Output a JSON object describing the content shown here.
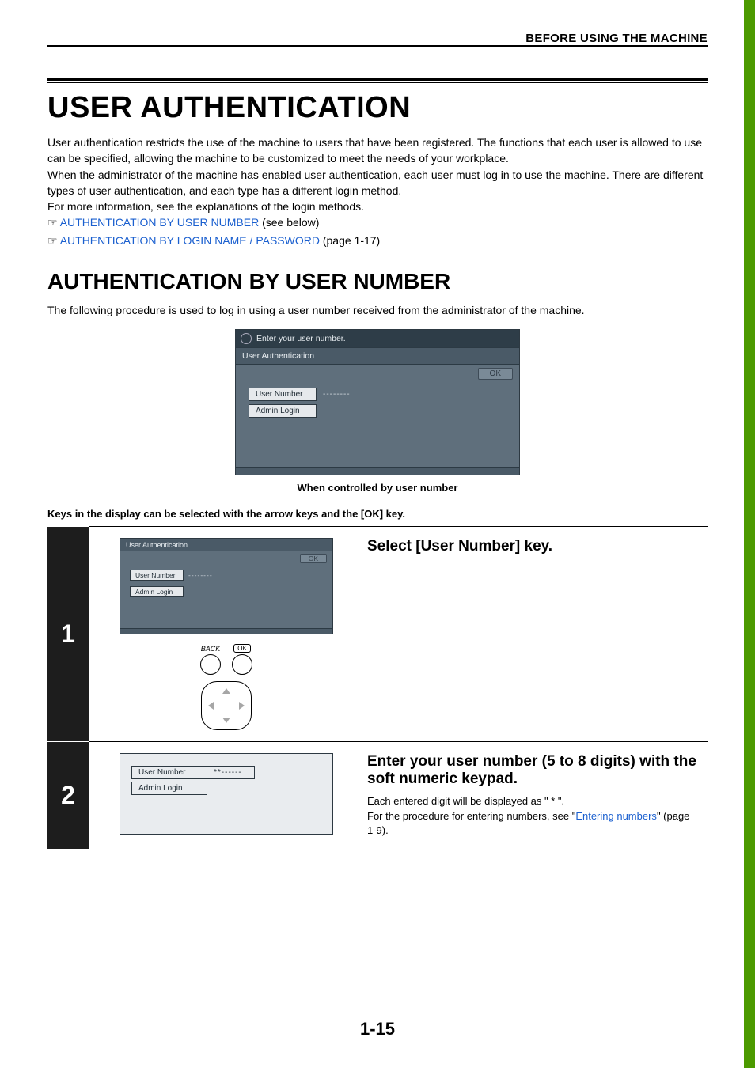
{
  "header": {
    "breadcrumb": "BEFORE USING THE MACHINE"
  },
  "title": "USER AUTHENTICATION",
  "intro": {
    "p1": "User authentication restricts the use of the machine to users that have been registered. The functions that each user is allowed to use can be specified, allowing the machine to be customized to meet the needs of your workplace.",
    "p2": "When the administrator of the machine has enabled user authentication, each user must log in to use the machine. There are different types of user authentication, and each type has a different login method.",
    "p3": "For more information, see the explanations of the login methods."
  },
  "links": {
    "pointer": "☞",
    "l1_text": "AUTHENTICATION BY USER NUMBER",
    "l1_suffix": " (see below)",
    "l2_text": "AUTHENTICATION BY LOGIN NAME / PASSWORD",
    "l2_suffix": " (page 1-17)"
  },
  "section2": {
    "heading": "AUTHENTICATION BY USER NUMBER",
    "lead": "The following procedure is used to log in using a user number received from the administrator of the machine."
  },
  "main_screen": {
    "prompt": "Enter your user number.",
    "subtitle": "User Authentication",
    "ok": "OK",
    "user_number_label": "User Number",
    "user_number_value": "--------",
    "admin_login_label": "Admin Login"
  },
  "main_caption": "When controlled by user number",
  "keys_note": "Keys in the display can be selected with the arrow keys and the [OK] key.",
  "step1": {
    "number": "1",
    "mini": {
      "subtitle": "User Authentication",
      "ok": "OK",
      "user_number_label": "User Number",
      "user_number_value": "--------",
      "admin_login_label": "Admin Login"
    },
    "nav": {
      "back": "BACK",
      "ok": "OK"
    },
    "title": "Select [User Number] key."
  },
  "step2": {
    "number": "2",
    "screen": {
      "user_number_label": "User Number",
      "user_number_value": "**------",
      "admin_login_label": "Admin Login"
    },
    "title": "Enter your user number (5 to 8 digits) with the soft numeric keypad.",
    "body_pre": "Each entered digit will be displayed as \" ",
    "body_star": "*",
    "body_post": " \".",
    "body2_pre": "For the procedure for entering numbers, see \"",
    "body2_link": "Entering numbers",
    "body2_post": "\" (page 1-9)."
  },
  "page_number": "1-15"
}
